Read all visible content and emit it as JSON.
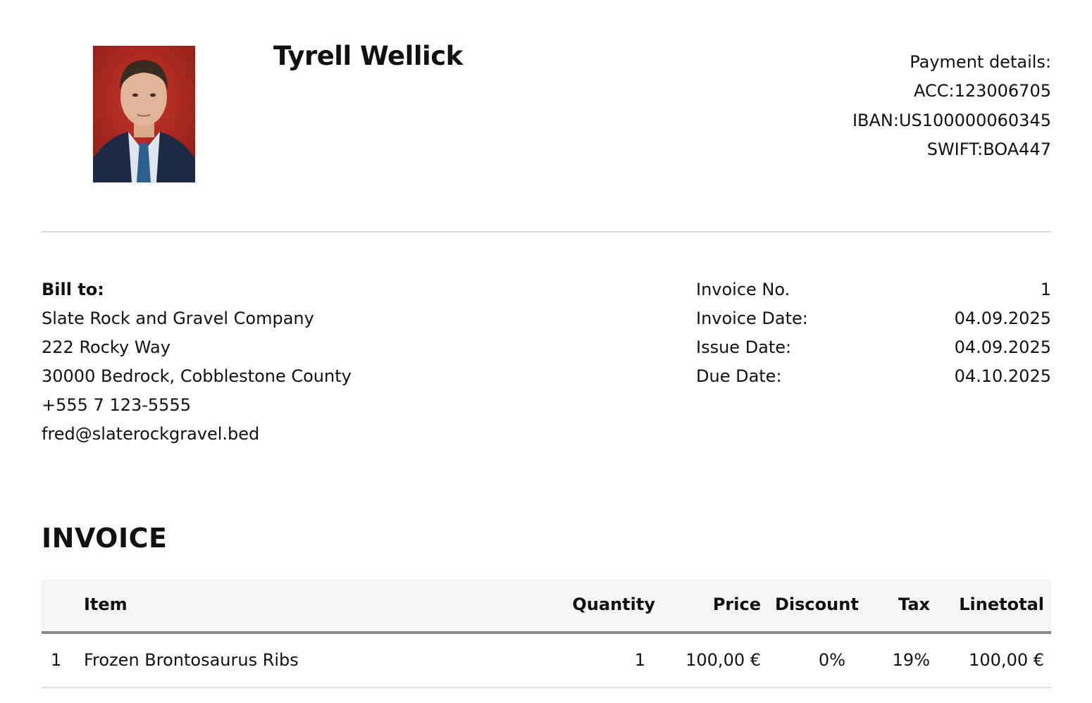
{
  "header": {
    "name": "Tyrell Wellick",
    "photo_alt": "Profile photo",
    "payment": {
      "heading": "Payment details:",
      "acc": "ACC:123006705",
      "iban": "IBAN:US100000060345",
      "swift": "SWIFT:BOA447"
    }
  },
  "bill_to": {
    "heading": "Bill to:",
    "company": "Slate Rock and Gravel Company",
    "street": "222 Rocky Way",
    "city": "30000 Bedrock, Cobblestone County",
    "phone": "+555 7 123-5555",
    "email": "fred@slaterockgravel.bed"
  },
  "invoice_meta": [
    {
      "label": "Invoice No.",
      "value": "1"
    },
    {
      "label": "Invoice Date:",
      "value": "04.09.2025"
    },
    {
      "label": "Issue Date:",
      "value": "04.09.2025"
    },
    {
      "label": "Due Date:",
      "value": "04.10.2025"
    }
  ],
  "title": "INVOICE",
  "table": {
    "columns": {
      "item": "Item",
      "quantity": "Quantity",
      "price": "Price",
      "discount": "Discount",
      "tax": "Tax",
      "linetotal": "Linetotal"
    },
    "rows": [
      {
        "index": "1",
        "item": "Frozen Brontosaurus Ribs",
        "quantity": "1",
        "price": "100,00 €",
        "discount": "0%",
        "tax": "19%",
        "linetotal": "100,00 €"
      }
    ]
  }
}
